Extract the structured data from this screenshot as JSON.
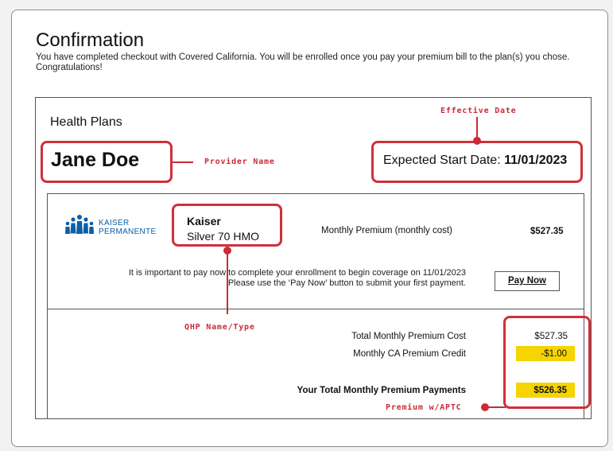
{
  "page": {
    "title": "Confirmation",
    "subtitle": "You have completed checkout with Covered California. You will be enrolled once you pay your premium bill to the plan(s) you chose. Congratulations!"
  },
  "section": {
    "heading": "Health Plans"
  },
  "enrollee": {
    "name": "Jane Doe"
  },
  "start_date": {
    "label": "Expected Start Date:",
    "value": "11/01/2023"
  },
  "annotations": {
    "effective_date": "Effective Date",
    "provider_name": "Provider Name",
    "qhp_name_type": "QHP Name/Type",
    "premium_aptc": "Premium w/APTC"
  },
  "plan": {
    "logo_line1": "KAISER",
    "logo_line2": "PERMANENTE",
    "carrier": "Kaiser",
    "type": "Silver 70 HMO",
    "monthly_premium_label": "Monthly Premium (monthly cost)",
    "monthly_premium_value": "$527.35",
    "message_line1": "It is important to pay now to complete your enrollment to begin coverage on 11/01/2023",
    "message_line2": "Please use the ‘Pay Now’ button to submit your first payment.",
    "pay_now_label": "Pay Now"
  },
  "summary": {
    "total_cost_label": "Total Monthly Premium Cost",
    "total_cost_value": "$527.35",
    "credit_label": "Monthly CA Premium Credit",
    "credit_value": "-$1.00",
    "total_payment_label": "Your Total Monthly Premium Payments",
    "total_payment_value": "$526.35"
  },
  "colors": {
    "annotation_red": "#cc2a36",
    "highlight_yellow": "#f6d400",
    "kaiser_blue": "#0b5fa7"
  }
}
